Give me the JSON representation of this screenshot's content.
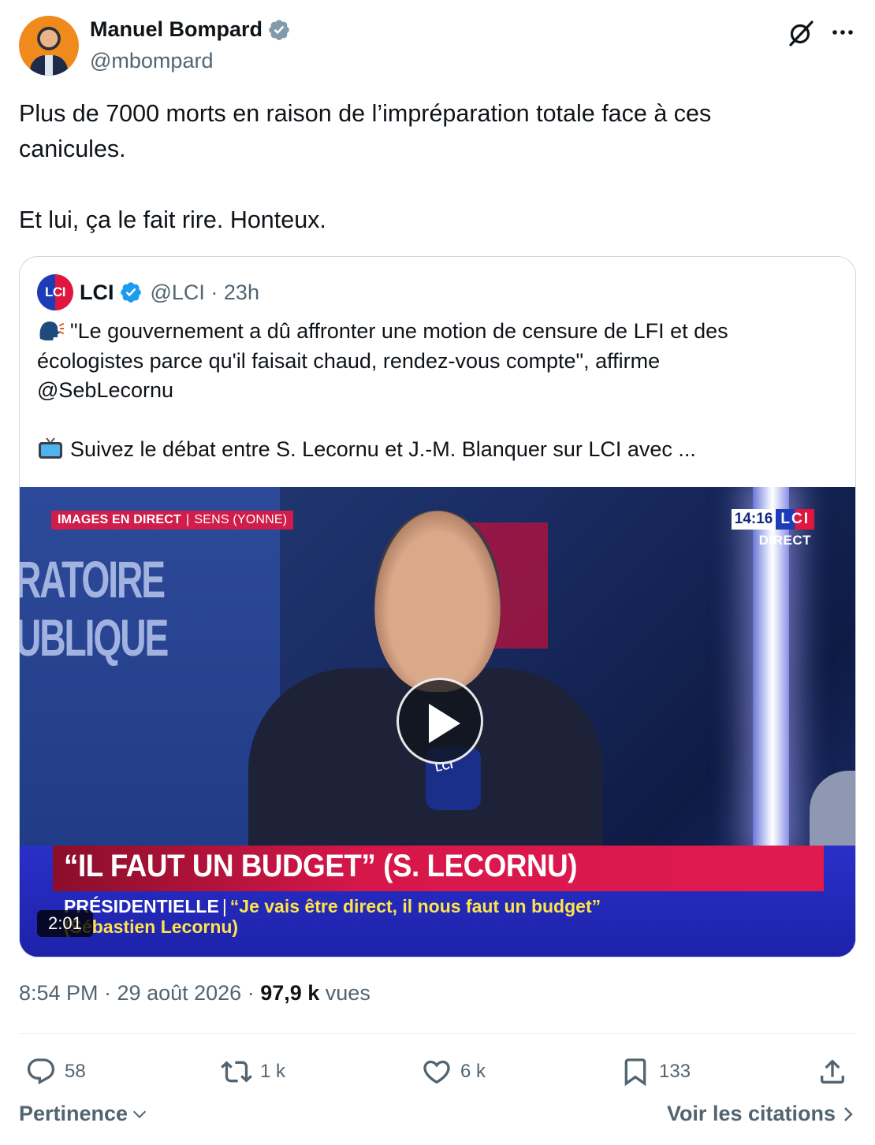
{
  "author": {
    "name": "Manuel Bompard",
    "handle": "@mbompard"
  },
  "tweet": {
    "line1": "Plus de 7000 morts en raison de l’impréparation totale face à ces",
    "line2": "canicules.",
    "line3": "Et lui, ça le fait rire. Honteux."
  },
  "quote": {
    "name": "LCI",
    "handle_time": "@LCI · 23h",
    "logo_text": "LCI",
    "line1": "\"Le gouvernement a dû affronter une motion de censure de LFI et des",
    "line2": "écologistes parce qu'il faisait chaud, rendez-vous compte\", affirme",
    "line3": "@SebLecornu",
    "line4": "Suivez le débat entre S. Lecornu et J.-M. Blanquer sur LCI avec ...",
    "video": {
      "tag_left": "IMAGES EN DIRECT",
      "tag_sep": "|",
      "tag_right": "SENS (YONNE)",
      "wall_line1": "RATOIRE",
      "wall_line2": "UBLIQUE",
      "clock": "14:16",
      "channel": "LCI",
      "live": "DIRECT",
      "headline": "“IL FAUT UN BUDGET” (S. LECORNU)",
      "sub_label": "PRÉSIDENTIELLE",
      "sub_bar": "|",
      "sub_quote": "“Je vais être direct, il nous faut un budget”",
      "sub_author": "(Sébastien Lecornu)",
      "mic_label": "LCI",
      "duration": "2:01"
    }
  },
  "meta": {
    "time_date": "8:54 PM · 29 août 2026 · ",
    "views_num": "97,9 k",
    "views_label": " vues"
  },
  "actions": {
    "replies": "58",
    "reposts": "1 k",
    "likes": "6 k",
    "bookmarks": "133"
  },
  "footer": {
    "sort_label": "Pertinence",
    "quotes_label": "Voir les citations"
  },
  "colors": {
    "verified": "#1d9bf0",
    "verified_gray": "#829aab",
    "secondary_text": "#536471",
    "primary_text": "#0f1419",
    "border": "#cfd9de"
  }
}
